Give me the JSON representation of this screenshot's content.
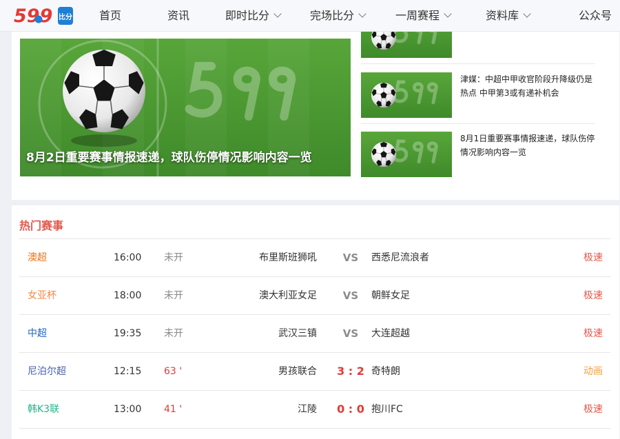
{
  "brand": {
    "logo_text": "599",
    "logo_side_text": "比分",
    "colors": {
      "red": "#e53935",
      "blue": "#1f7fd6"
    }
  },
  "nav": {
    "items": [
      {
        "label": "首页",
        "dropdown": false
      },
      {
        "label": "资讯",
        "dropdown": false
      },
      {
        "label": "即时比分",
        "dropdown": true
      },
      {
        "label": "完场比分",
        "dropdown": true
      },
      {
        "label": "一周赛程",
        "dropdown": true
      },
      {
        "label": "资料库",
        "dropdown": true
      },
      {
        "label": "公众号",
        "dropdown": false
      }
    ]
  },
  "news": {
    "hero": {
      "caption": "8月2日重要赛事情报速递，球队伤停情况影响内容一览"
    },
    "side_items": [
      {
        "title": ""
      },
      {
        "title": "津媒：中超中甲收官阶段升降级仍是热点 中甲第3或有递补机会"
      },
      {
        "title": "8月1日重要赛事情报速递，球队伤停情况影响内容一览"
      }
    ]
  },
  "hot": {
    "title": "热门赛事",
    "matches": [
      {
        "league": "澳超",
        "league_color": "#e8731a",
        "time": "16:00",
        "status": "未开",
        "live": false,
        "home": "布里斯班狮吼",
        "mid": "VS",
        "is_score": false,
        "away": "西悉尼流浪者",
        "link": "极速",
        "link_type": "fast"
      },
      {
        "league": "女亚杯",
        "league_color": "#f08a4b",
        "time": "18:00",
        "status": "未开",
        "live": false,
        "home": "澳大利亚女足",
        "mid": "VS",
        "is_score": false,
        "away": "朝鲜女足",
        "link": "极速",
        "link_type": "fast"
      },
      {
        "league": "中超",
        "league_color": "#1e64c8",
        "time": "19:35",
        "status": "未开",
        "live": false,
        "home": "武汉三镇",
        "mid": "VS",
        "is_score": false,
        "away": "大连超越",
        "link": "极速",
        "link_type": "fast"
      },
      {
        "league": "尼泊尔超",
        "league_color": "#4a5fa8",
        "time": "12:15",
        "status": "63 '",
        "live": true,
        "home": "男孩联合",
        "mid": "3 : 2",
        "is_score": true,
        "away": "奇特朗",
        "link": "动画",
        "link_type": "anim"
      },
      {
        "league": "韩K3联",
        "league_color": "#21b58c",
        "time": "13:00",
        "status": "41 '",
        "live": true,
        "home": "江陵",
        "mid": "0 : 0",
        "is_score": true,
        "away": "抱川FC",
        "link": "极速",
        "link_type": "fast"
      }
    ]
  }
}
